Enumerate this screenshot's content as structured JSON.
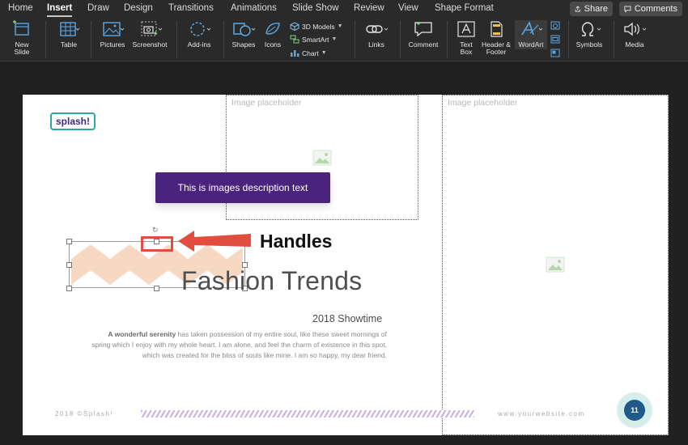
{
  "menu": {
    "tabs": [
      "Home",
      "Insert",
      "Draw",
      "Design",
      "Transitions",
      "Animations",
      "Slide Show",
      "Review",
      "View",
      "Shape Format"
    ],
    "active_tab": "Insert",
    "share_label": "Share",
    "comments_label": "Comments"
  },
  "ribbon": {
    "new_slide": "New Slide",
    "table": "Table",
    "pictures": "Pictures",
    "screenshot": "Screenshot",
    "addins": "Add-ins",
    "shapes": "Shapes",
    "icons": "Icons",
    "models_3d": "3D Models",
    "smartart": "SmartArt",
    "chart": "Chart",
    "links": "Links",
    "comment": "Comment",
    "text_box": "Text Box",
    "header_footer": "Header & Footer",
    "wordart": "WordArt",
    "symbols": "Symbols",
    "media": "Media"
  },
  "slide": {
    "placeholder_1": "Image placeholder",
    "placeholder_2": "Image placeholder",
    "logo": "splash!",
    "tooltip": "This is images description text",
    "callout": "Handles",
    "title": "Fashion Trends",
    "subtitle": "2018 Showtime",
    "body_bold": "A wonderful serenity",
    "body_rest": " has taken possession of my entire soul, like these sweet mornings of spring which I enjoy with my whole heart. I am alone, and feel the charm of existence in this spot, which was created for the bliss of souls like mine. I am so happy, my dear friend.",
    "footer_left": "2018 ©Splash!",
    "footer_right": "www.yourwebsite.com",
    "page_number": "11"
  },
  "colors": {
    "tooltip_bg": "#4b237d",
    "highlight_red": "#e24d3f",
    "zigzag": "#f6d8c3",
    "logo_border": "#2aa7a2"
  }
}
